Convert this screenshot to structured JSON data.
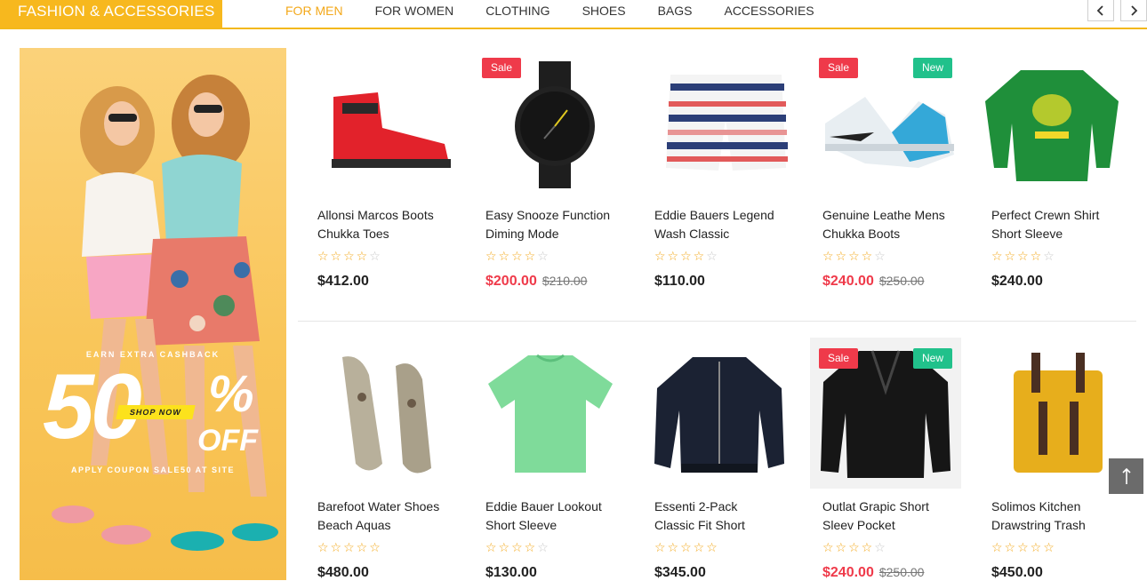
{
  "header": {
    "category_title": "FASHION & ACCESSORIES",
    "tabs": [
      "FOR MEN",
      "FOR WOMEN",
      "CLOTHING",
      "SHOES",
      "BAGS",
      "ACCESSORIES"
    ],
    "active_tab": "FOR MEN",
    "prev_icon": "chevron-left-icon",
    "next_icon": "chevron-right-icon"
  },
  "banner": {
    "caption_top": "EARN EXTRA CASHBACK",
    "big_number": "50",
    "percent": "%",
    "off": "OFF",
    "shop_now": "SHOP NOW",
    "caption_bottom": "APPLY COUPON SALE50 AT SITE"
  },
  "products": [
    {
      "name_line1": "Allonsi Marcos Boots",
      "name_line2": "Chukka Toes",
      "rating": 4,
      "price": "$412.00",
      "old_price": "",
      "on_sale": false,
      "badges": []
    },
    {
      "name_line1": "Easy Snooze Function",
      "name_line2": "Diming Mode",
      "rating": 4,
      "price": "$200.00",
      "old_price": "$210.00",
      "on_sale": true,
      "badges": [
        "Sale"
      ]
    },
    {
      "name_line1": "Eddie Bauers Legend",
      "name_line2": "Wash Classic",
      "rating": 4,
      "price": "$110.00",
      "old_price": "",
      "on_sale": false,
      "badges": []
    },
    {
      "name_line1": "Genuine Leathe Mens",
      "name_line2": "Chukka Boots",
      "rating": 4,
      "price": "$240.00",
      "old_price": "$250.00",
      "on_sale": true,
      "badges": [
        "Sale",
        "New"
      ]
    },
    {
      "name_line1": "Perfect Crewn Shirt",
      "name_line2": "Short Sleeve",
      "rating": 4,
      "price": "$240.00",
      "old_price": "",
      "on_sale": false,
      "badges": []
    },
    {
      "name_line1": "Barefoot Water Shoes",
      "name_line2": "Beach Aquas",
      "rating": 5,
      "price": "$480.00",
      "old_price": "",
      "on_sale": false,
      "badges": []
    },
    {
      "name_line1": "Eddie Bauer Lookout",
      "name_line2": "Short Sleeve",
      "rating": 4,
      "price": "$130.00",
      "old_price": "",
      "on_sale": false,
      "badges": []
    },
    {
      "name_line1": "Essenti 2-Pack",
      "name_line2": "Classic Fit Short",
      "rating": 5,
      "price": "$345.00",
      "old_price": "",
      "on_sale": false,
      "badges": []
    },
    {
      "name_line1": "Outlat Grapic Short",
      "name_line2": "Sleev Pocket",
      "rating": 4,
      "price": "$240.00",
      "old_price": "$250.00",
      "on_sale": true,
      "badges": [
        "Sale",
        "New"
      ]
    },
    {
      "name_line1": "Solimos Kitchen",
      "name_line2": "Drawstring Trash",
      "rating": 5,
      "price": "$450.00",
      "old_price": "",
      "on_sale": false,
      "badges": []
    }
  ],
  "product_icons": [
    "red-sneaker-icon",
    "wristwatch-icon",
    "striped-shorts-icon",
    "basketball-shoe-icon",
    "sweatshirt-icon",
    "loafer-shoes-icon",
    "green-tshirt-icon",
    "bomber-jacket-icon",
    "leather-jacket-icon",
    "backpack-icon"
  ],
  "scroll_top_icon": "arrow-up-icon",
  "colors": {
    "accent": "#f7b81e",
    "sale": "#ef3a4a",
    "new": "#21c18b",
    "star": "#f3a81a"
  }
}
